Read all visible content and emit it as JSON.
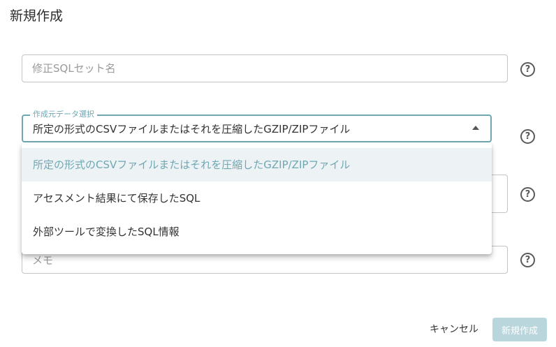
{
  "dialog": {
    "title": "新規作成"
  },
  "form": {
    "sql_set_name": {
      "placeholder": "修正SQLセット名",
      "value": ""
    },
    "source_select": {
      "label": "作成元データ選択",
      "selected": "所定の形式のCSVファイルまたはそれを圧縮したGZIP/ZIPファイル",
      "options": [
        "所定の形式のCSVファイルまたはそれを圧縮したGZIP/ZIPファイル",
        "アセスメント結果にて保存したSQL",
        "外部ツールで変換したSQL情報"
      ]
    },
    "memo": {
      "placeholder": "メモ"
    }
  },
  "help_icon_glyph": "?",
  "actions": {
    "cancel_label": "キャンセル",
    "create_label": "新規作成"
  },
  "colors": {
    "accent": "#6fa7b3",
    "selected_option_bg": "#edf3f5",
    "create_button_disabled": "#b9d6dd"
  }
}
